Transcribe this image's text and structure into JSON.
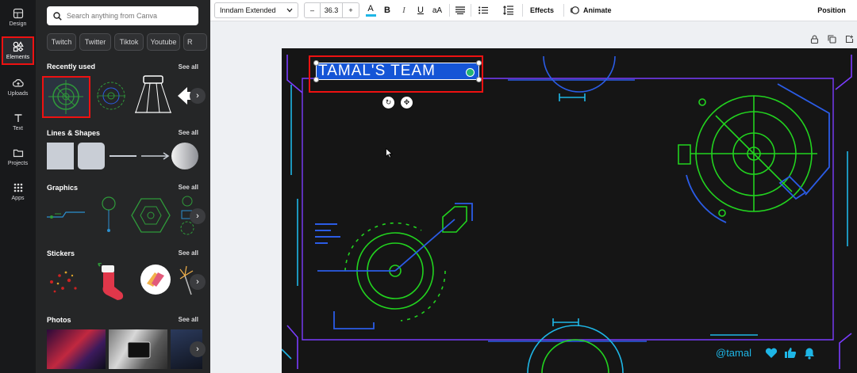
{
  "rail": {
    "items": [
      {
        "label": "Design",
        "icon": "design-icon"
      },
      {
        "label": "Elements",
        "icon": "elements-icon"
      },
      {
        "label": "Uploads",
        "icon": "upload-icon"
      },
      {
        "label": "Text",
        "icon": "text-icon"
      },
      {
        "label": "Projects",
        "icon": "folder-icon"
      },
      {
        "label": "Apps",
        "icon": "apps-grid-icon"
      }
    ]
  },
  "panel": {
    "search_placeholder": "Search anything from Canva",
    "chips": [
      "Twitch",
      "Twitter",
      "Tiktok",
      "Youtube",
      "R"
    ],
    "sections": {
      "recent": "Recently used",
      "lines": "Lines & Shapes",
      "graphics": "Graphics",
      "stickers": "Stickers",
      "photos": "Photos"
    },
    "see_all": "See all"
  },
  "toolbar": {
    "font": "Inndam Extended",
    "minus": "–",
    "size": "36.3",
    "plus": "+",
    "color_letter": "A",
    "bold": "B",
    "italic": "I",
    "underline": "U",
    "case": "aA",
    "effects": "Effects",
    "animate": "Animate",
    "position": "Position",
    "text_color": "#1eb6e6"
  },
  "canvas": {
    "title_text": "TAMAL'S TEAM",
    "footer_handle": "@tamal",
    "neon_green": "#22d31f",
    "neon_blue": "#2b5ce6",
    "neon_cyan": "#1eb6e6",
    "neon_purple": "#7a3cff"
  }
}
